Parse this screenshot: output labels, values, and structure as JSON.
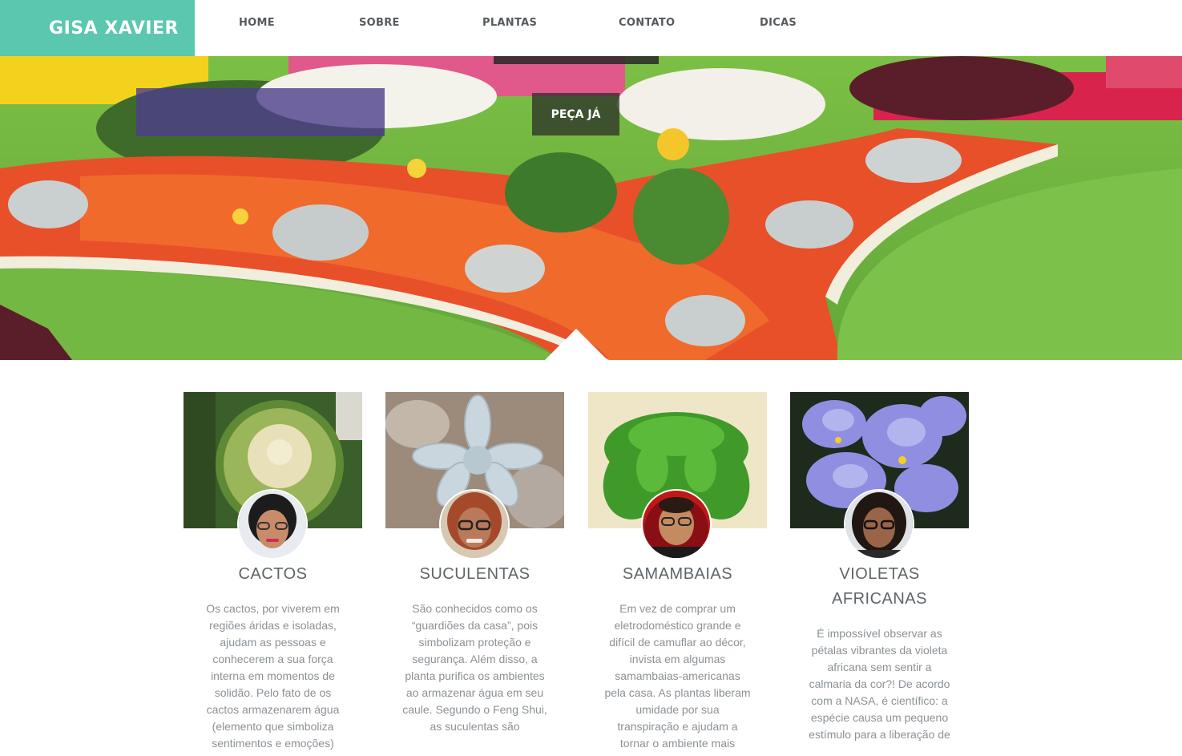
{
  "header": {
    "brand": "GISA XAVIER",
    "nav": [
      {
        "label": "HOME"
      },
      {
        "label": "SOBRE"
      },
      {
        "label": "PLANTAS"
      },
      {
        "label": "CONTATO"
      },
      {
        "label": "DICAS"
      }
    ]
  },
  "hero": {
    "cta_label": "PEÇA JÁ",
    "image": "flower-garden-photo"
  },
  "cards": [
    {
      "title": "CACTOS",
      "image": "golden-barrel-cactus-photo",
      "text": "Os cactos, por viverem em regiões áridas e isoladas, ajudam as pessoas e conhecerem a sua força interna em momentos de solidão. Pelo fato de os cactos armazenarem água (elemento que simboliza sentimentos e emoções)"
    },
    {
      "title": "SUCULENTAS",
      "image": "succulent-rosette-photo",
      "text": "São conhecidos como os “guardiões da casa”, pois simbolizam proteção e segurança. Além disso, a planta purifica os ambientes ao armazenar água em seu caule. Segundo o Feng Shui, as suculentas são"
    },
    {
      "title": "SAMAMBAIAS",
      "image": "fern-photo",
      "text": "Em vez de comprar um eletrodoméstico grande e difícil de camuflar ao décor, invista em algumas samambaias-americanas pela casa. As plantas liberam umidade por sua transpiração e ajudam a tornar o ambiente mais"
    },
    {
      "title": "VIOLETAS AFRICANAS",
      "image": "african-violet-photo",
      "text": "É impossível observar as pétalas vibrantes da violeta africana sem sentir a calmaria da cor?! De acordo com a NASA, é científico: a espécie causa um pequeno estímulo para a liberação de"
    }
  ],
  "colors": {
    "brand": "#5ac7ae",
    "nav_text": "#555a5e",
    "title_text": "#5e6569",
    "body_text": "#8b9196"
  }
}
